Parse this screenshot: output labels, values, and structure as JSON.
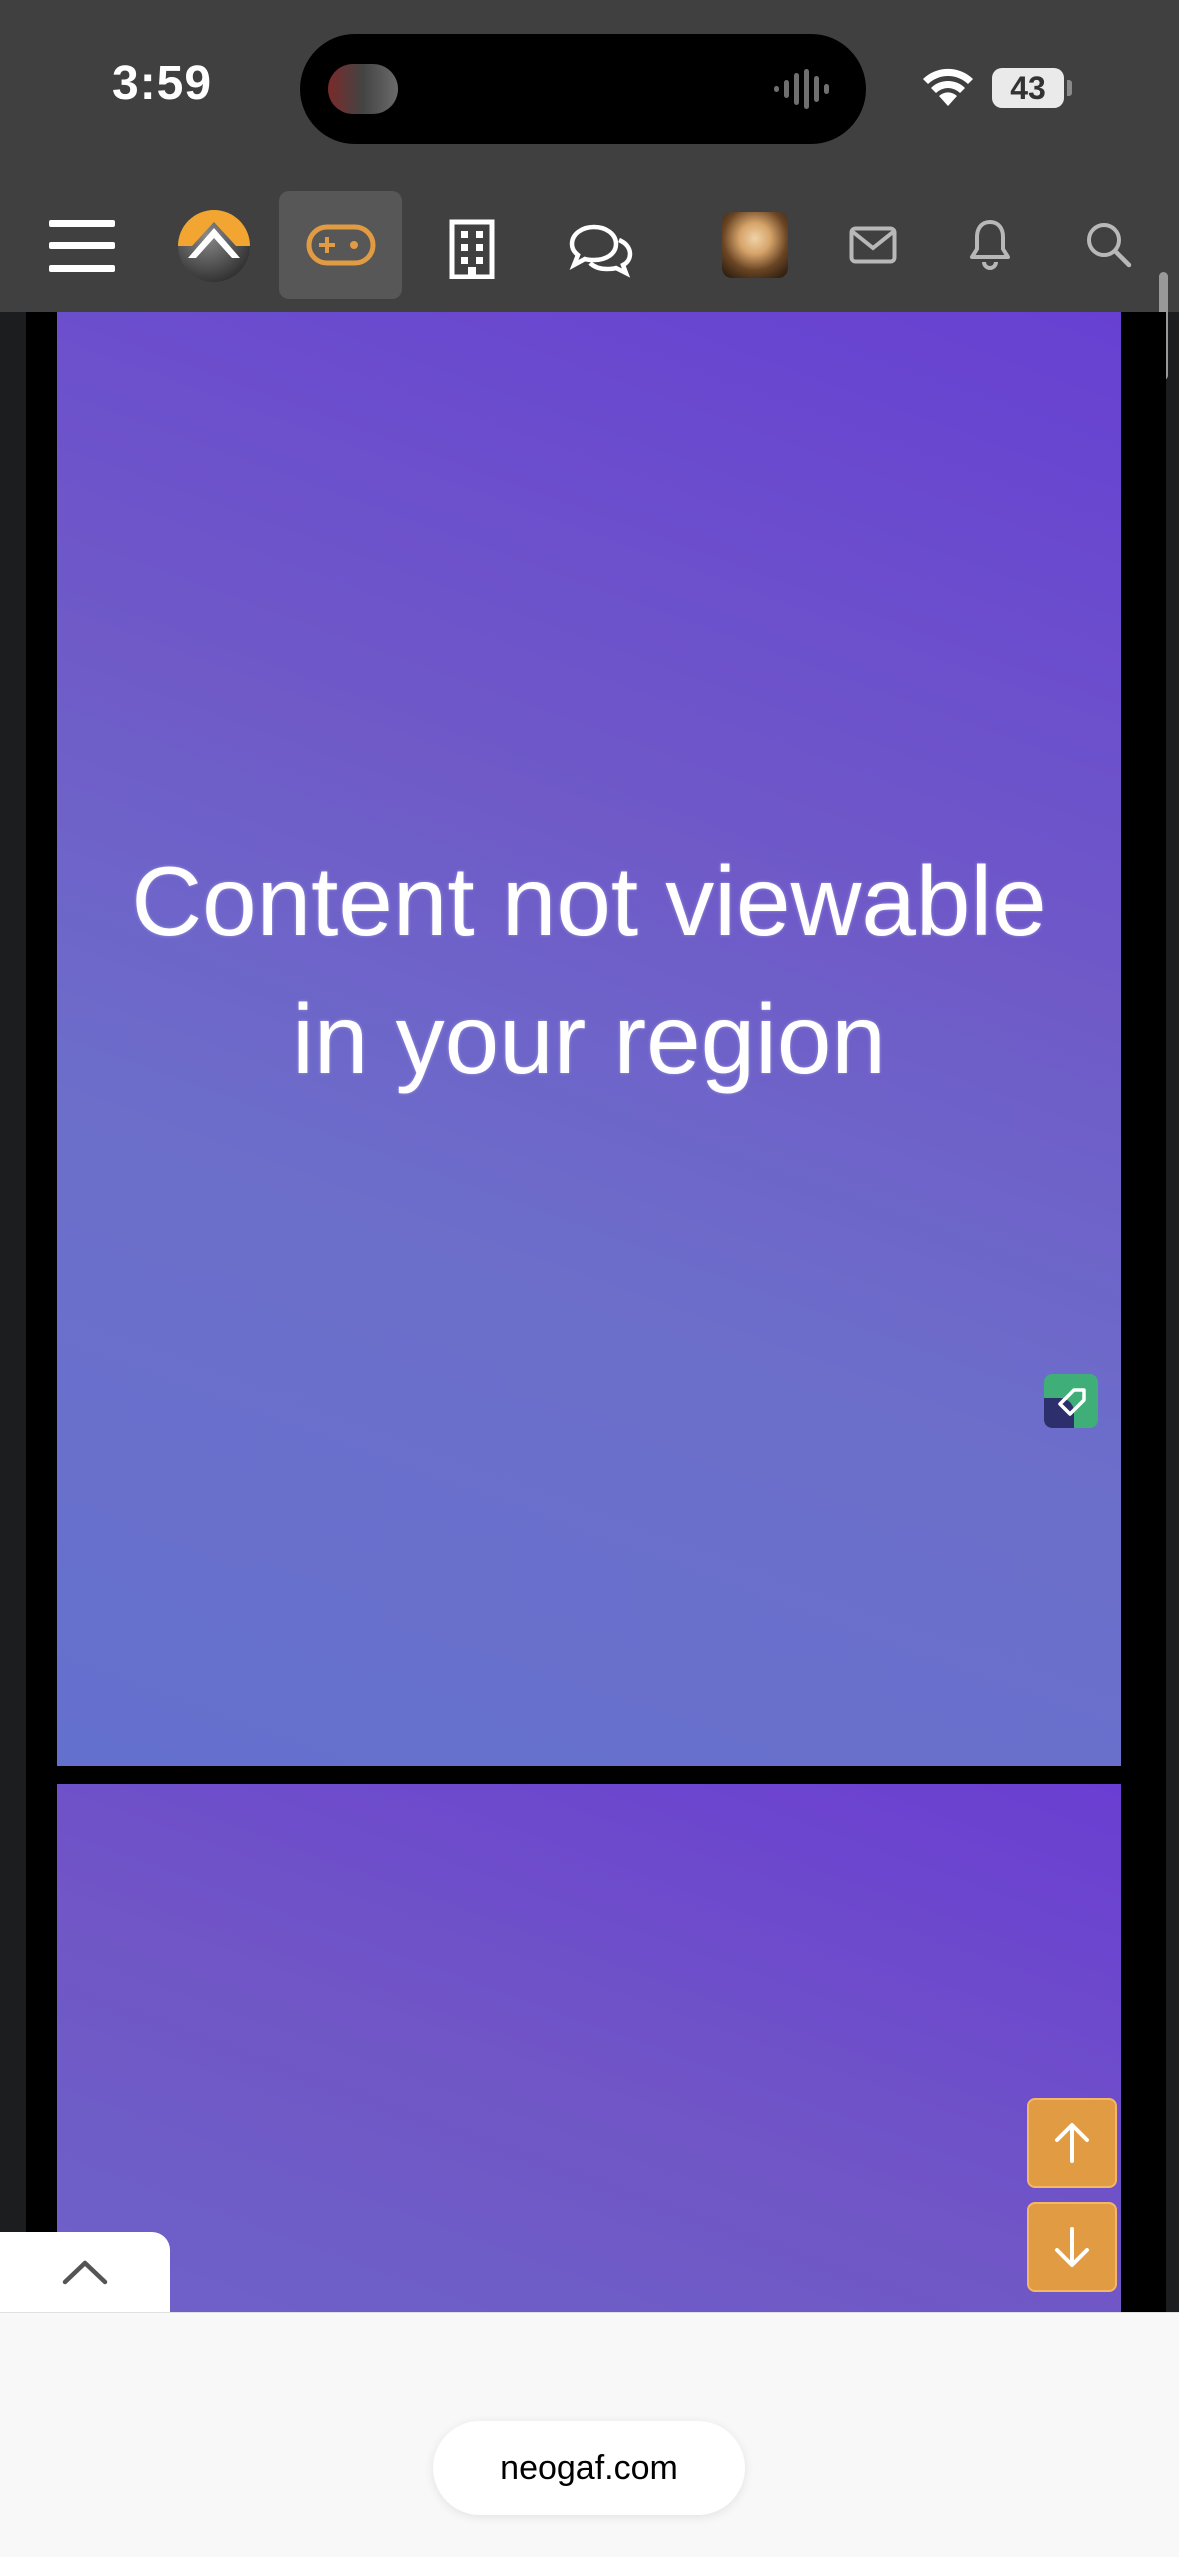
{
  "status_bar": {
    "time": "3:59",
    "battery": "43",
    "island_activity_icon": "video-thumbnail-icon",
    "island_audio_icon": "waveform-icon",
    "signal_icon": "wifi-icon"
  },
  "nav": {
    "items": [
      {
        "name": "menu",
        "icon": "hamburger-icon"
      },
      {
        "name": "logo",
        "icon": "neogaf-logo-icon"
      },
      {
        "name": "gaming",
        "icon": "gamepad-icon",
        "active": true
      },
      {
        "name": "offtopic",
        "icon": "building-icon"
      },
      {
        "name": "forums",
        "icon": "chat-bubbles-icon"
      },
      {
        "name": "account",
        "icon": "avatar"
      },
      {
        "name": "inbox",
        "icon": "envelope-icon"
      },
      {
        "name": "alerts",
        "icon": "bell-icon"
      },
      {
        "name": "search",
        "icon": "search-icon"
      }
    ],
    "accent_color": "#e19b42"
  },
  "content": {
    "blocked_message_line1": "Content not viewable",
    "blocked_message_line2": "in your region",
    "embed_icon": "embed-badge-icon",
    "scroll_up_icon": "arrow-up-icon",
    "scroll_down_icon": "arrow-down-icon",
    "collapse_icon": "chevron-up-icon"
  },
  "browser": {
    "url": "neogaf.com"
  },
  "colors": {
    "header_bg": "#404040",
    "page_bg": "#1c1d1f",
    "media_purple": "#6a4ed0",
    "scroll_button": "#e19b42"
  }
}
